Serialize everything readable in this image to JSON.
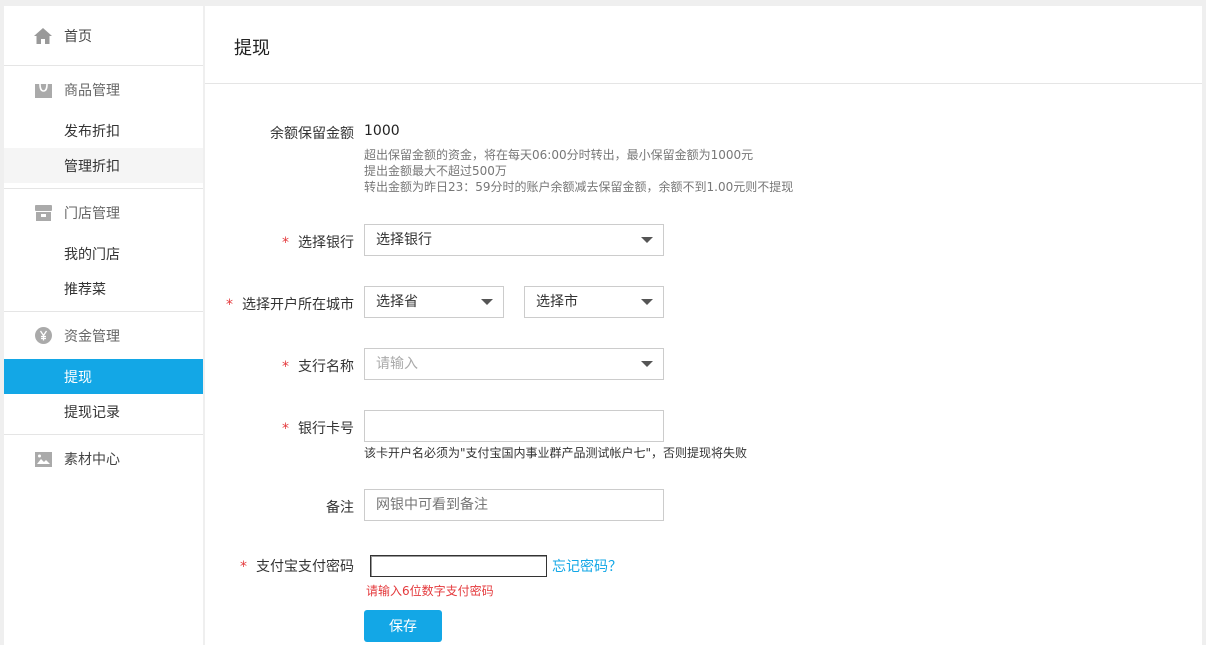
{
  "sidebar": {
    "home": {
      "label": "首页",
      "icon": "home-icon"
    },
    "groups": [
      {
        "label": "商品管理",
        "icon": "shopping-bag-icon",
        "items": [
          "发布折扣",
          "管理折扣"
        ]
      },
      {
        "label": "门店管理",
        "icon": "store-icon",
        "items": [
          "我的门店",
          "推荐菜"
        ]
      },
      {
        "label": "资金管理",
        "icon": "yen-icon",
        "items": [
          "提现",
          "提现记录"
        ]
      }
    ],
    "material": {
      "label": "素材中心",
      "icon": "image-icon"
    },
    "active_item": "提现",
    "hover_item": "管理折扣"
  },
  "page": {
    "title": "提现"
  },
  "form": {
    "reserve": {
      "label": "余额保留金额",
      "value": "1000",
      "tips": [
        "超出保留金额的资金，将在每天06:00分时转出，最小保留金额为1000元",
        "提出金额最大不超过500万",
        "转出金额为昨日23：59分时的账户余额减去保留金额，余额不到1.00元则不提现"
      ]
    },
    "bank": {
      "label": "选择银行",
      "value": "选择银行"
    },
    "city": {
      "label": "选择开户所在城市",
      "province": "选择省",
      "city": "选择市"
    },
    "branch": {
      "label": "支行名称",
      "placeholder": "请输入"
    },
    "card": {
      "label": "银行卡号",
      "value": "",
      "note": "该卡开户名必须为\"支付宝国内事业群产品测试帐户七\"，否则提现将失败"
    },
    "remark": {
      "label": "备注",
      "placeholder": "网银中可看到备注"
    },
    "password": {
      "label": "支付宝支付密码",
      "forgot": "忘记密码？",
      "error": "请输入6位数字支付密码"
    },
    "required_mark": "*",
    "save": "保存"
  },
  "colors": {
    "accent": "#13a7e6",
    "error": "#e4393c"
  }
}
